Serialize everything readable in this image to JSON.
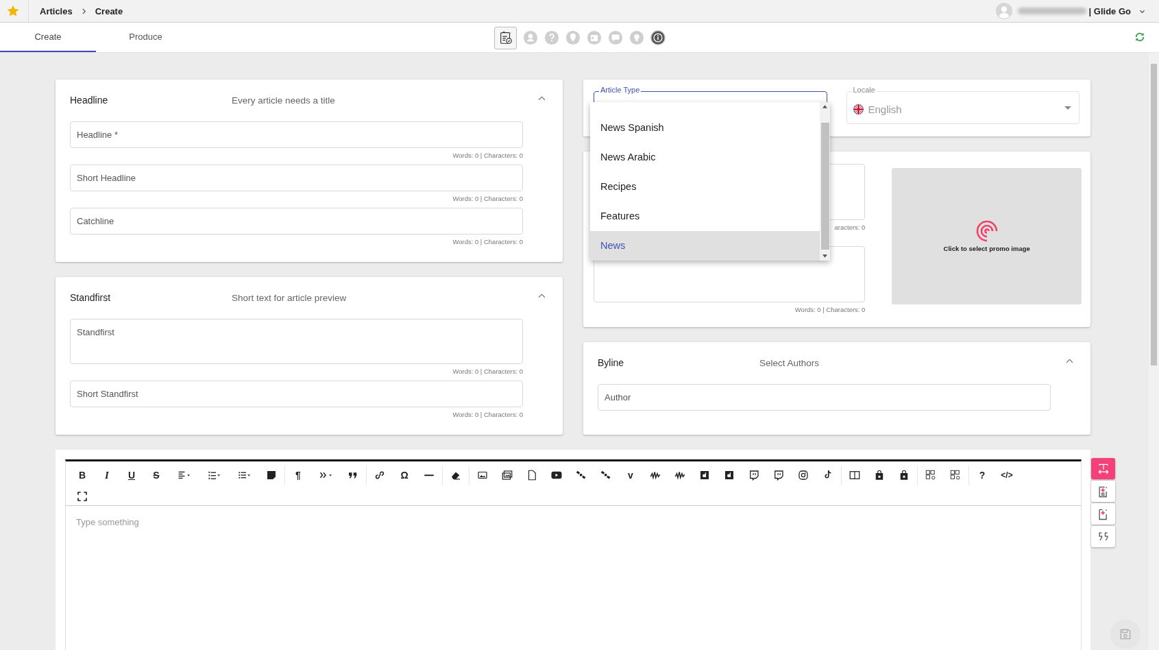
{
  "breadcrumb": {
    "items": [
      "Articles",
      "Create"
    ],
    "account": "| Glide Go"
  },
  "tabs": [
    {
      "label": "Create",
      "selected": true
    },
    {
      "label": "Produce",
      "selected": false
    }
  ],
  "toolbar_icons": [
    {
      "kind": "checklist",
      "selected": true
    },
    {
      "kind": "user",
      "selected": false
    },
    {
      "kind": "help",
      "selected": false
    },
    {
      "kind": "pin",
      "selected": false
    },
    {
      "kind": "calendar",
      "selected": false
    },
    {
      "kind": "chat",
      "selected": false
    },
    {
      "kind": "bulb",
      "selected": false
    },
    {
      "kind": "info",
      "selected": false
    }
  ],
  "headline_card": {
    "title": "Headline",
    "subtitle": "Every article needs a title",
    "expanded": true,
    "fields": [
      {
        "placeholder": "Headline *",
        "counter": "Words: 0 | Characters: 0",
        "kind": "line"
      },
      {
        "placeholder": "Short Headline",
        "counter": "Words: 0 | Characters: 0",
        "kind": "line"
      },
      {
        "placeholder": "Catchline",
        "counter": "Words: 0 | Characters: 0",
        "kind": "line"
      }
    ]
  },
  "standfirst_card": {
    "title": "Standfirst",
    "subtitle": "Short text for article preview",
    "expanded": true,
    "fields": [
      {
        "placeholder": "Standfirst",
        "counter": "Words: 0 | Characters: 0",
        "kind": "area"
      },
      {
        "placeholder": "Short Standfirst",
        "counter": "Words: 0 | Characters: 0",
        "kind": "line"
      }
    ]
  },
  "article_type": {
    "label": "Article Type",
    "options": [
      {
        "label": "News Spanish",
        "selected": false
      },
      {
        "label": "News Arabic",
        "selected": false
      },
      {
        "label": "Recipes",
        "selected": false
      },
      {
        "label": "Features",
        "selected": false
      },
      {
        "label": "News",
        "selected": true
      }
    ]
  },
  "locale": {
    "label": "Locale",
    "value": "English"
  },
  "promo_card": {
    "counters": [
      "aracters: 0",
      "Words: 0 | Characters: 0"
    ],
    "image_prompt": "Click to select promo image"
  },
  "byline_card": {
    "title": "Byline",
    "subtitle": "Select Authors",
    "expanded": true,
    "field_placeholder": "Author"
  },
  "editor": {
    "glyphs": [
      "B",
      "I",
      "U",
      "S",
      "¶",
      "Ω",
      "v",
      "?",
      "</>"
    ],
    "placeholder": "Type something"
  },
  "side_buttons": [
    {
      "kind": "text-width",
      "selected": true
    },
    {
      "kind": "sparkle-doc",
      "selected": false
    },
    {
      "kind": "sparkle-page",
      "selected": false
    },
    {
      "kind": "quote",
      "selected": false
    }
  ]
}
